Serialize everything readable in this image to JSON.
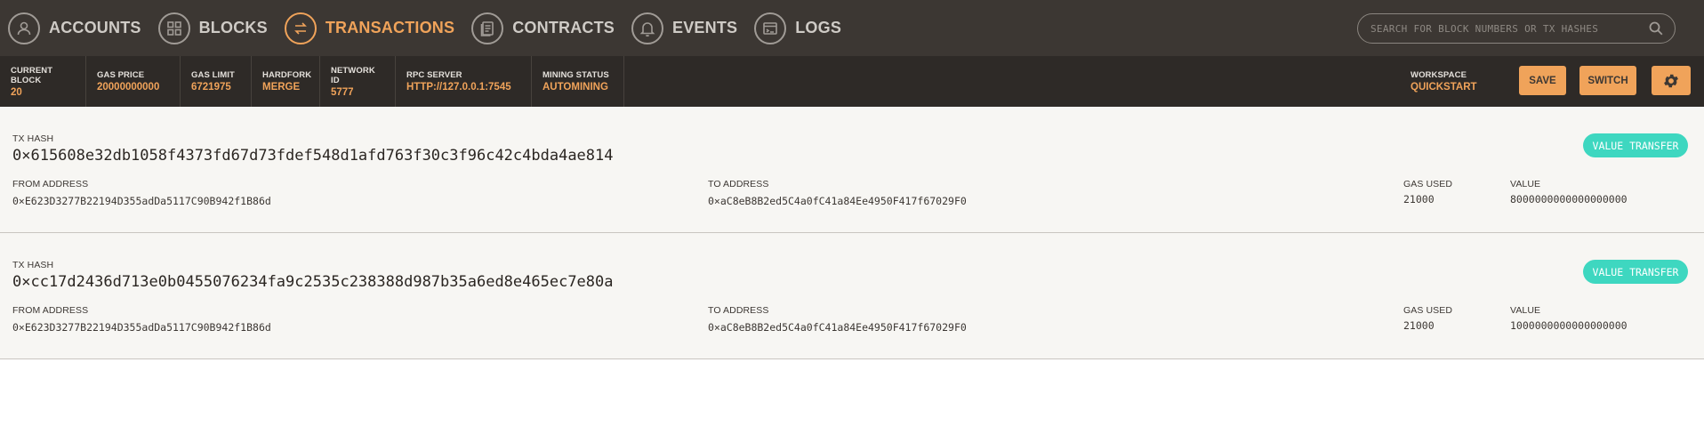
{
  "nav": {
    "items": [
      {
        "label": "ACCOUNTS",
        "icon": "account-icon",
        "active": false
      },
      {
        "label": "BLOCKS",
        "icon": "blocks-icon",
        "active": false
      },
      {
        "label": "TRANSACTIONS",
        "icon": "transactions-icon",
        "active": true
      },
      {
        "label": "CONTRACTS",
        "icon": "contracts-icon",
        "active": false
      },
      {
        "label": "EVENTS",
        "icon": "bell-icon",
        "active": false
      },
      {
        "label": "LOGS",
        "icon": "logs-icon",
        "active": false
      }
    ],
    "search_placeholder": "SEARCH FOR BLOCK NUMBERS OR TX HASHES"
  },
  "status": {
    "current_block": {
      "label": "CURRENT BLOCK",
      "value": "20"
    },
    "gas_price": {
      "label": "GAS PRICE",
      "value": "20000000000"
    },
    "gas_limit": {
      "label": "GAS LIMIT",
      "value": "6721975"
    },
    "hardfork": {
      "label": "HARDFORK",
      "value": "MERGE"
    },
    "network_id": {
      "label": "NETWORK ID",
      "value": "5777"
    },
    "rpc_server": {
      "label": "RPC SERVER",
      "value": "HTTP://127.0.0.1:7545"
    },
    "mining_status": {
      "label": "MINING STATUS",
      "value": "AUTOMINING"
    },
    "workspace": {
      "label": "WORKSPACE",
      "value": "QUICKSTART"
    },
    "save_label": "SAVE",
    "switch_label": "SWITCH"
  },
  "tx_labels": {
    "hash": "TX HASH",
    "from": "FROM ADDRESS",
    "to": "TO ADDRESS",
    "gas_used": "GAS USED",
    "value": "VALUE"
  },
  "transactions": [
    {
      "hash": "0×615608e32db1058f4373fd67d73fdef548d1afd763f30c3f96c42c4bda4ae814",
      "from": "0×E623D3277B22194D355adDa5117C90B942f1B86d",
      "to": "0×aC8eB8B2ed5C4a0fC41a84Ee4950F417f67029F0",
      "gas_used": "21000",
      "value": "8000000000000000000",
      "type": "VALUE TRANSFER"
    },
    {
      "hash": "0×cc17d2436d713e0b0455076234fa9c2535c238388d987b35a6ed8e465ec7e80a",
      "from": "0×E623D3277B22194D355adDa5117C90B942f1B86d",
      "to": "0×aC8eB8B2ed5C4a0fC41a84Ee4950F417f67029F0",
      "gas_used": "21000",
      "value": "1000000000000000000",
      "type": "VALUE TRANSFER"
    }
  ],
  "colors": {
    "accent": "#f0a35a",
    "badge": "#3ed7c0",
    "nav_bg": "#3c3733",
    "status_bg": "#2e2a27"
  }
}
